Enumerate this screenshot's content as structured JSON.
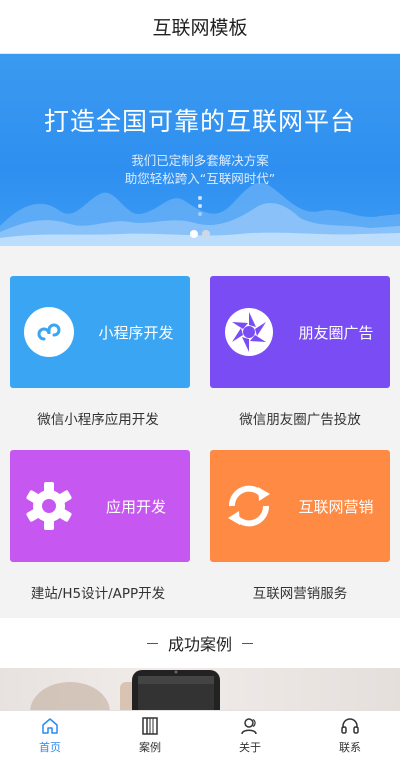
{
  "header": {
    "title": "互联网模板"
  },
  "banner": {
    "title": "打造全国可靠的互联网平台",
    "subtitle_line1": "我们已定制多套解决方案",
    "subtitle_line2": "助您轻松跨入“互联网时代”",
    "slides": 2,
    "active_slide": 1
  },
  "services": [
    {
      "label": "小程序开发",
      "desc": "微信小程序应用开发",
      "icon": "mini-program-icon",
      "color": "#3aa5f3"
    },
    {
      "label": "朋友圈广告",
      "desc": "微信朋友圈广告投放",
      "icon": "aperture-icon",
      "color": "#7a4df4"
    },
    {
      "label": "应用开发",
      "desc": "建站/H5设计/APP开发",
      "icon": "gear-icon",
      "color": "#c657f0"
    },
    {
      "label": "互联网营销",
      "desc": "互联网营销服务",
      "icon": "refresh-icon",
      "color": "#ff8a44"
    }
  ],
  "cases": {
    "title": "成功案例"
  },
  "tabbar": {
    "items": [
      {
        "label": "首页",
        "icon": "home-icon",
        "active": true
      },
      {
        "label": "案例",
        "icon": "book-icon",
        "active": false
      },
      {
        "label": "关于",
        "icon": "people-icon",
        "active": false
      },
      {
        "label": "联系",
        "icon": "headset-icon",
        "active": false
      }
    ],
    "active_color": "#2c8af0"
  }
}
